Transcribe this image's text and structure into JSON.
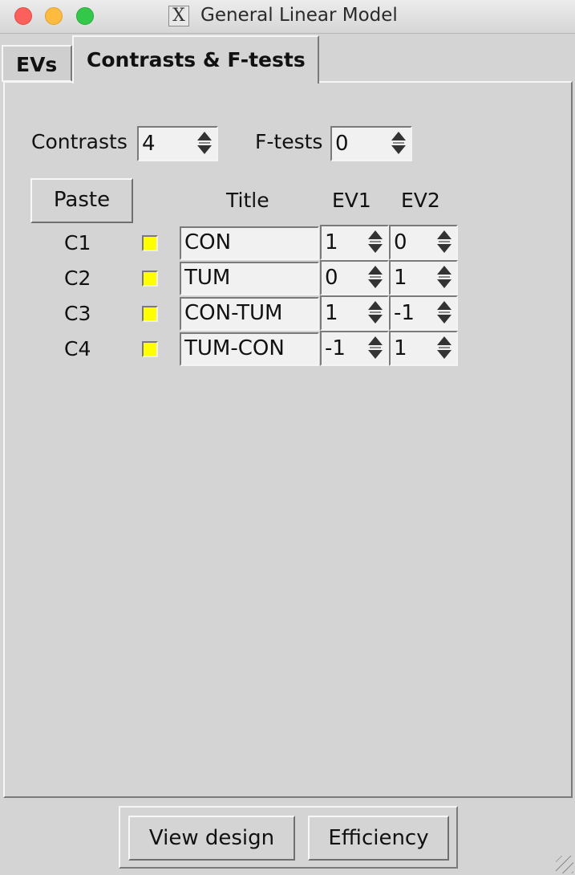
{
  "window": {
    "title": "General Linear Model",
    "icon": "x11-icon"
  },
  "tabs": [
    {
      "label": "EVs",
      "active": false
    },
    {
      "label": "Contrasts & F-tests",
      "active": true
    }
  ],
  "counts": {
    "contrasts_label": "Contrasts",
    "contrasts_value": "4",
    "ftests_label": "F-tests",
    "ftests_value": "0"
  },
  "table": {
    "paste_label": "Paste",
    "headers": {
      "title": "Title",
      "ev1": "EV1",
      "ev2": "EV2"
    },
    "rows": [
      {
        "name": "C1",
        "title": "CON",
        "ev1": "1",
        "ev2": "0"
      },
      {
        "name": "C2",
        "title": "TUM",
        "ev1": "0",
        "ev2": "1"
      },
      {
        "name": "C3",
        "title": "CON-TUM",
        "ev1": "1",
        "ev2": "-1"
      },
      {
        "name": "C4",
        "title": "TUM-CON",
        "ev1": "-1",
        "ev2": "1"
      }
    ],
    "swatch_color": "#ffff00"
  },
  "footer": {
    "view_design_label": "View design",
    "efficiency_label": "Efficiency"
  }
}
